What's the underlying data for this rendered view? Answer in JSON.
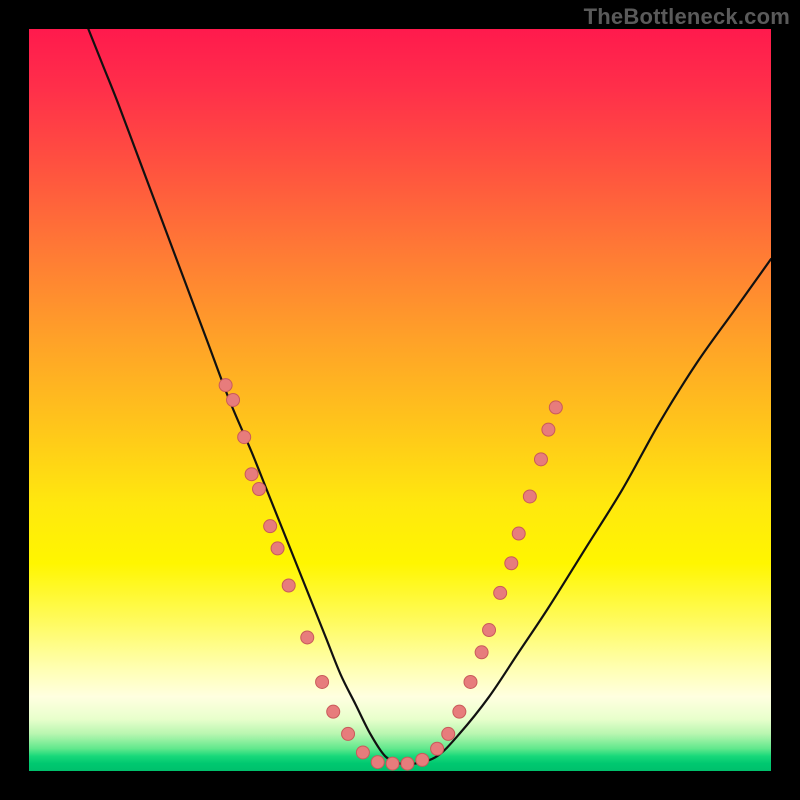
{
  "watermark": "TheBottleneck.com",
  "colors": {
    "background": "#000000",
    "curve_stroke": "#111111",
    "dot_fill": "#e77c7c",
    "dot_stroke": "#c95a5a"
  },
  "chart_data": {
    "type": "line",
    "title": "",
    "xlabel": "",
    "ylabel": "",
    "xlim": [
      0,
      100
    ],
    "ylim": [
      0,
      100
    ],
    "grid": false,
    "legend": null,
    "series": [
      {
        "name": "bottleneck-curve",
        "x": [
          8,
          10,
          12,
          15,
          18,
          21,
          24,
          27,
          30,
          32,
          34,
          36,
          38,
          40,
          42,
          44,
          46,
          48,
          50,
          52,
          55,
          58,
          62,
          66,
          70,
          75,
          80,
          85,
          90,
          95,
          100
        ],
        "y": [
          100,
          95,
          90,
          82,
          74,
          66,
          58,
          50,
          43,
          38,
          33,
          28,
          23,
          18,
          13,
          9,
          5,
          2,
          1,
          1,
          2,
          5,
          10,
          16,
          22,
          30,
          38,
          47,
          55,
          62,
          69
        ]
      }
    ],
    "markers": [
      {
        "x": 26.5,
        "y": 52
      },
      {
        "x": 27.5,
        "y": 50
      },
      {
        "x": 29.0,
        "y": 45
      },
      {
        "x": 30.0,
        "y": 40
      },
      {
        "x": 31.0,
        "y": 38
      },
      {
        "x": 32.5,
        "y": 33
      },
      {
        "x": 33.5,
        "y": 30
      },
      {
        "x": 35.0,
        "y": 25
      },
      {
        "x": 37.5,
        "y": 18
      },
      {
        "x": 39.5,
        "y": 12
      },
      {
        "x": 41.0,
        "y": 8
      },
      {
        "x": 43.0,
        "y": 5
      },
      {
        "x": 45.0,
        "y": 2.5
      },
      {
        "x": 47.0,
        "y": 1.2
      },
      {
        "x": 49.0,
        "y": 1
      },
      {
        "x": 51.0,
        "y": 1
      },
      {
        "x": 53.0,
        "y": 1.5
      },
      {
        "x": 55.0,
        "y": 3
      },
      {
        "x": 56.5,
        "y": 5
      },
      {
        "x": 58.0,
        "y": 8
      },
      {
        "x": 59.5,
        "y": 12
      },
      {
        "x": 61.0,
        "y": 16
      },
      {
        "x": 62.0,
        "y": 19
      },
      {
        "x": 63.5,
        "y": 24
      },
      {
        "x": 65.0,
        "y": 28
      },
      {
        "x": 66.0,
        "y": 32
      },
      {
        "x": 67.5,
        "y": 37
      },
      {
        "x": 69.0,
        "y": 42
      },
      {
        "x": 70.0,
        "y": 46
      },
      {
        "x": 71.0,
        "y": 49
      }
    ]
  }
}
